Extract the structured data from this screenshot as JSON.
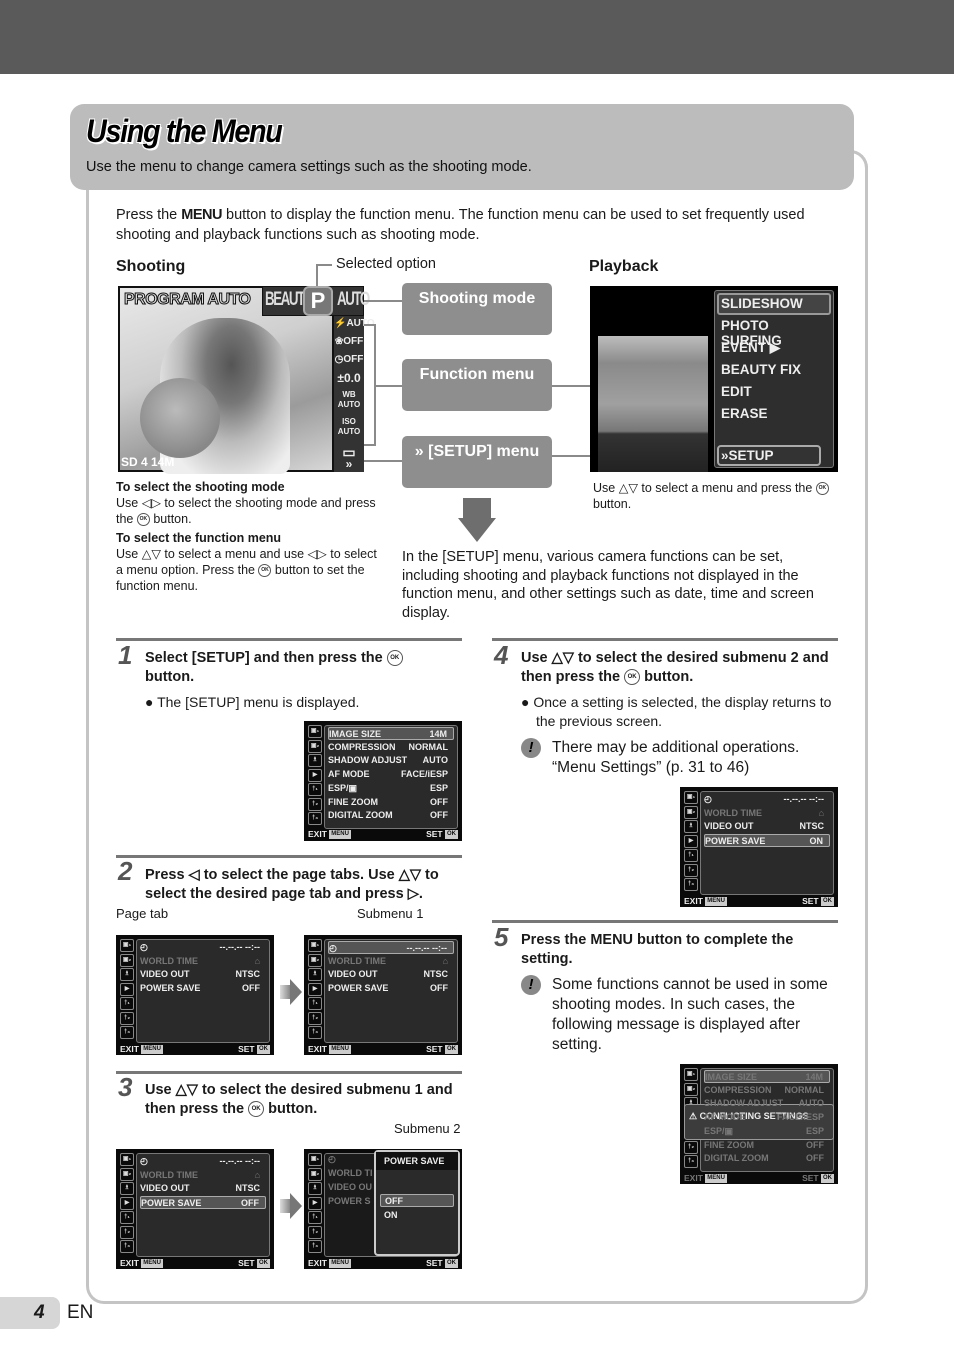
{
  "page": {
    "number": "4",
    "lang": "EN"
  },
  "header": {
    "title": "Using the Menu",
    "subtitle": "Use the menu to change camera settings such as the shooting mode."
  },
  "intro": {
    "pre": "Press the ",
    "menu_word": "MENU",
    "post": " button to display the function menu. The function menu can be used to set frequently used shooting and playback functions such as shooting mode."
  },
  "shooting": {
    "heading": "Shooting",
    "selected_option_label": "Selected option",
    "screen": {
      "mode_name": "PROGRAM AUTO",
      "mode_strip": [
        "BEAUTY",
        "P",
        "AUTO"
      ],
      "function_items": [
        "⚡AUTO",
        "❀OFF",
        "◷OFF",
        "±0.0",
        "WB AUTO",
        "ISO AUTO",
        "▭",
        "»"
      ],
      "status": "SD 4 14M"
    },
    "instructions": [
      {
        "title": "To select the shooting mode",
        "text_pre": "Use ◁▷ to select the shooting mode and press the ",
        "text_post": " button."
      },
      {
        "title": "To select the function menu",
        "text_pre": "Use △▽ to select a menu and use ◁▷ to select a menu option. Press the ",
        "text_post": " button to set the function menu."
      }
    ]
  },
  "callouts": {
    "shooting_mode": "Shooting mode",
    "function_menu": "Function menu",
    "setup_menu_icon": "»",
    "setup_menu": "[SETUP] menu"
  },
  "playback": {
    "heading": "Playback",
    "menu_items": [
      "SLIDESHOW",
      "PHOTO SURFING",
      "EVENT ▶",
      "BEAUTY FIX",
      "EDIT",
      "ERASE"
    ],
    "setup_item": "SETUP",
    "instruction_pre": "Use △▽ to select a menu and press the ",
    "instruction_post": " button."
  },
  "ok_glyph": "OK",
  "setup_description": "In the [SETUP] menu, various camera functions can be set, including shooting and playback functions not displayed in the function menu, and other settings such as date, time and screen display.",
  "steps": [
    {
      "num": "1",
      "text_pre": "Select [SETUP] and then press the ",
      "text_post": " button.",
      "bullet": "The [SETUP] menu is displayed."
    },
    {
      "num": "2",
      "text": "Press ◁ to select the page tabs. Use △▽ to select the desired page tab and press ▷.",
      "labels": [
        "Page tab",
        "Submenu 1"
      ]
    },
    {
      "num": "3",
      "text_pre": "Use △▽ to select the desired submenu 1 and then press the ",
      "text_post": " button.",
      "labels": [
        "Submenu 2"
      ]
    },
    {
      "num": "4",
      "text_pre": "Use △▽ to select the desired submenu 2 and then press the ",
      "text_post": " button.",
      "bullet": "Once a setting is selected, the display returns to the previous screen.",
      "note": "There may be additional operations. “Menu Settings” (p. 31 to 46)"
    },
    {
      "num": "5",
      "text_pre": "Press the ",
      "menu_word": "MENU",
      "text_post": " button to complete the setting.",
      "note": "Some functions cannot be used in some shooting modes. In such cases, the following message is displayed after setting."
    }
  ],
  "screens": {
    "tabs": [
      "▣₁",
      "▣₂",
      "♗",
      "▶",
      "†₁",
      "†₂",
      "†₃"
    ],
    "footer_exit": "EXIT",
    "footer_menu": "MENU",
    "footer_set": "SET",
    "footer_ok": "OK",
    "setup1": [
      {
        "k": "IMAGE SIZE",
        "v": "14M"
      },
      {
        "k": "COMPRESSION",
        "v": "NORMAL"
      },
      {
        "k": "SHADOW ADJUST",
        "v": "AUTO"
      },
      {
        "k": "AF MODE",
        "v": "FACE/iESP"
      },
      {
        "k": "ESP/▣",
        "v": "ESP"
      },
      {
        "k": "FINE ZOOM",
        "v": "OFF"
      },
      {
        "k": "DIGITAL ZOOM",
        "v": "OFF"
      }
    ],
    "setup3": [
      {
        "k": "◴",
        "v": "--.--.-- --:--"
      },
      {
        "k": "WORLD TIME",
        "v": "⌂"
      },
      {
        "k": "VIDEO OUT",
        "v": "NTSC"
      },
      {
        "k": "POWER SAVE",
        "v": "OFF"
      }
    ],
    "setup3_on": [
      {
        "k": "◴",
        "v": "--.--.-- --:--"
      },
      {
        "k": "WORLD TIME",
        "v": "⌂"
      },
      {
        "k": "VIDEO OUT",
        "v": "NTSC"
      },
      {
        "k": "POWER SAVE",
        "v": "ON"
      }
    ],
    "submenu2": {
      "title": "POWER SAVE",
      "options": [
        "OFF",
        "ON"
      ],
      "left_rows": [
        "◴",
        "WORLD TI",
        "VIDEO OU",
        "POWER S"
      ]
    },
    "conflict": "CONFLICTING SETTINGS"
  }
}
